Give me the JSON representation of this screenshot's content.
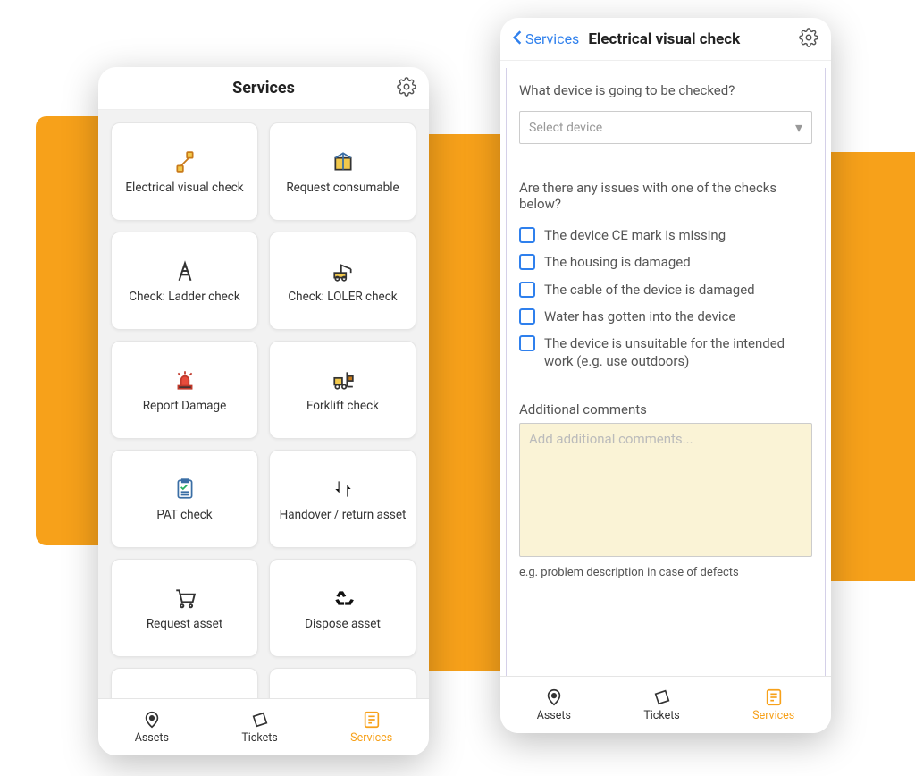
{
  "left": {
    "title": "Services",
    "tiles": [
      {
        "label": "Electrical visual check",
        "icon": "plug"
      },
      {
        "label": "Request consumable",
        "icon": "package"
      },
      {
        "label": "Check: Ladder check",
        "icon": "ladder"
      },
      {
        "label": "Check: LOLER check",
        "icon": "crane"
      },
      {
        "label": "Report Damage",
        "icon": "siren"
      },
      {
        "label": "Forklift check",
        "icon": "forklift"
      },
      {
        "label": "PAT check",
        "icon": "checklist"
      },
      {
        "label": "Handover / return asset",
        "icon": "transfer"
      },
      {
        "label": "Request asset",
        "icon": "cart"
      },
      {
        "label": "Dispose asset",
        "icon": "recycle"
      },
      {
        "label": "",
        "icon": "blank1"
      },
      {
        "label": "",
        "icon": "blank2"
      }
    ]
  },
  "right": {
    "back_label": "Services",
    "title": "Electrical visual check",
    "q1": "What device is going to be checked?",
    "select_placeholder": "Select device",
    "q2": "Are there any issues with one of the checks below?",
    "checks": [
      "The device CE mark is missing",
      "The housing is damaged",
      "The cable of the device is damaged",
      "Water has gotten into the device",
      "The device is unsuitable for the intended work (e.g. use outdoors)"
    ],
    "comments_label": "Additional comments",
    "comments_placeholder": "Add additional comments...",
    "comments_helper": "e.g. problem description in case of defects"
  },
  "nav": {
    "assets": "Assets",
    "tickets": "Tickets",
    "services": "Services"
  }
}
